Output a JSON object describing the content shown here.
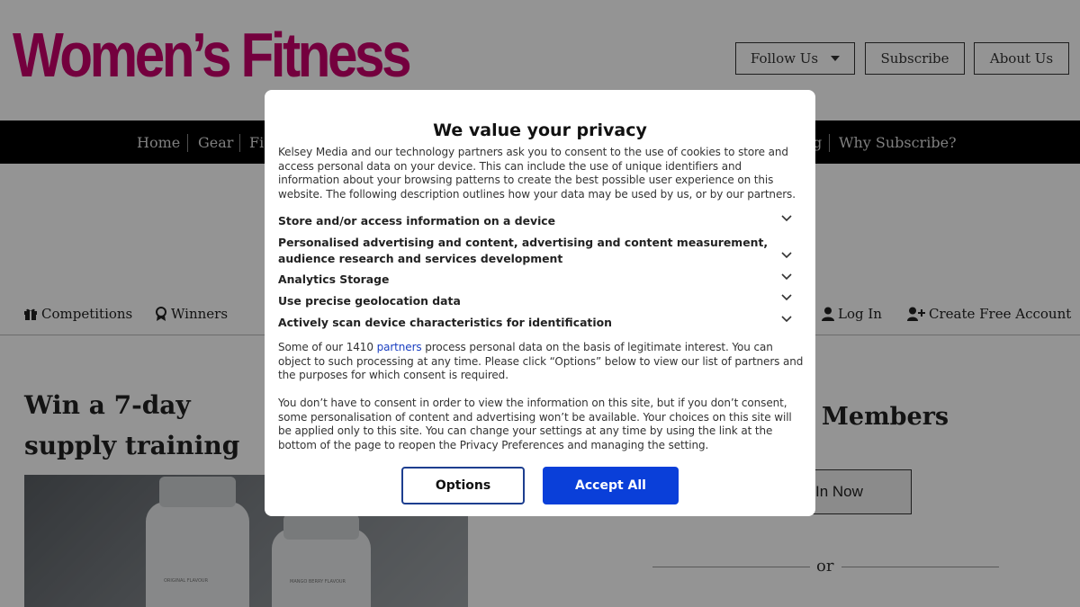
{
  "header": {
    "logo": "Women’s Fitness",
    "follow_us": "Follow Us",
    "subscribe": "Subscribe",
    "about_us": "About Us"
  },
  "nav": {
    "items": [
      "Home",
      "Gear",
      "Fi",
      "g",
      "Why Subscribe?"
    ]
  },
  "subnav": {
    "competitions": "Competitions",
    "winners": "Winners",
    "log_in": "Log In",
    "create_account": "Create Free Account"
  },
  "article": {
    "title": "Win a 7-day supply training T-shirt",
    "bottle_label_1": "ORIGINAL FLAVOUR",
    "bottle_label_2": "MANGO BERRY FLAVOUR"
  },
  "sidebar": {
    "members_title": "Members",
    "login_now": "In Now",
    "or": "or"
  },
  "dialog": {
    "title": "We value your privacy",
    "intro": "Kelsey Media and our technology partners ask you to consent to the use of cookies to store and access personal data on your device. This can include the use of unique identifiers and information about your browsing patterns to create the best possible user experience on this website. The following description outlines how your data may be used by us, or by our partners.",
    "purposes": [
      "Store and/or access information on a device",
      "Personalised advertising and content, advertising and content measurement, audience research and services development",
      "Analytics Storage",
      "Use precise geolocation data",
      "Actively scan device characteristics for identification"
    ],
    "partners_before": "Some of our 1410 ",
    "partners_link": "partners",
    "partners_after": " process personal data on the basis of legitimate interest. You can object to such processing at any time. Please click “Options” below to view our list of partners and the purposes for which consent is required.",
    "consent_note": "You don’t have to consent in order to view the information on this site, but if you don’t consent, some personalisation of content and advertising won’t be available. Your choices on this site will be applied only to this site. You can change your settings at any time by using the link at the bottom of the page to reopen the Privacy Preferences and managing the setting.",
    "options_label": "Options",
    "accept_label": "Accept All"
  },
  "colors": {
    "brand": "#c8006b",
    "accept": "#0a3fd9",
    "link": "#1a3fc1"
  }
}
